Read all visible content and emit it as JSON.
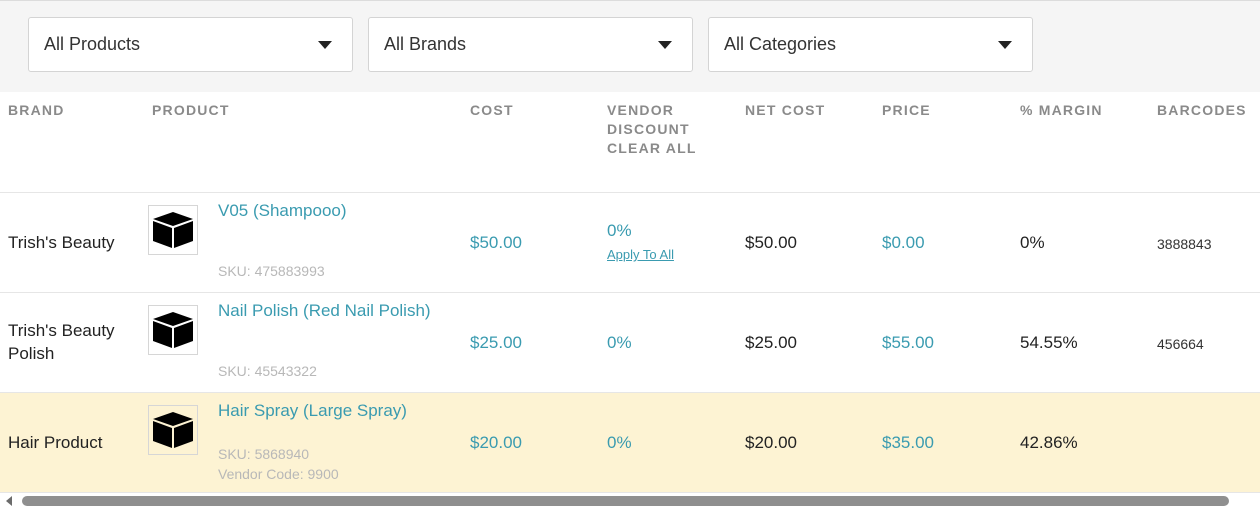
{
  "filters": {
    "products": "All Products",
    "brands": "All Brands",
    "categories": "All Categories"
  },
  "columns": {
    "brand": "BRAND",
    "product": "PRODUCT",
    "cost": "COST",
    "vendor_discount_1": "VENDOR",
    "vendor_discount_2": "DISCOUNT",
    "clear_all": "CLEAR ALL",
    "net_cost": "NET COST",
    "price": "PRICE",
    "margin": "% MARGIN",
    "barcodes": "BARCODES"
  },
  "rows": [
    {
      "brand": "Trish's Beauty",
      "product": "V05 (Shampooo)",
      "sku": "SKU: 475883993",
      "cost": "$50.00",
      "discount": "0%",
      "apply": "Apply To All",
      "net_cost": "$50.00",
      "price": "$0.00",
      "margin": "0%",
      "barcode": "3888843"
    },
    {
      "brand_line1": "Trish's Beauty",
      "brand_line2": "Polish",
      "product": "Nail Polish (Red Nail Polish)",
      "sku": "SKU: 45543322",
      "cost": "$25.00",
      "discount": "0%",
      "net_cost": "$25.00",
      "price": "$55.00",
      "margin": "54.55%",
      "barcode": "456664"
    },
    {
      "brand": "Hair Product",
      "product": "Hair Spray (Large Spray)",
      "sku": "SKU: 5868940",
      "vendor_code": "Vendor Code: 9900",
      "cost": "$20.00",
      "discount": "0%",
      "net_cost": "$20.00",
      "price": "$35.00",
      "margin": "42.86%",
      "barcode": ""
    }
  ],
  "icons": {
    "product_thumb": "box-icon",
    "dropdown": "caret-down-icon",
    "scroll_left": "scroll-left-arrow-icon"
  },
  "colors": {
    "accent": "#3a9bb0",
    "highlight_row": "#fdf3d3",
    "header_text": "#8a8a8a"
  }
}
